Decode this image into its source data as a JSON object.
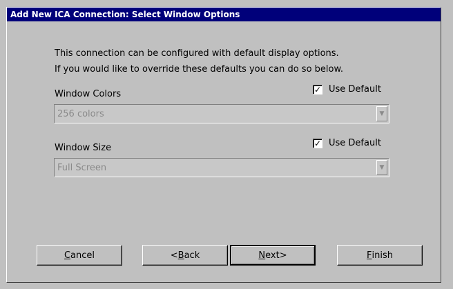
{
  "dialog": {
    "title": "Add New ICA Connection: Select Window Options",
    "intro_line1": "This connection can be configured with default display options.",
    "intro_line2": "If you would like to override these defaults you can do so below."
  },
  "window_colors": {
    "label": "Window Colors",
    "use_default_label": "Use Default",
    "use_default_checked": true,
    "value": "256 colors"
  },
  "window_size": {
    "label": "Window Size",
    "use_default_label": "Use Default",
    "use_default_checked": true,
    "value": "Full Screen"
  },
  "buttons": {
    "cancel": {
      "pre": "",
      "mnemonic": "C",
      "post": "ancel"
    },
    "back": {
      "pre": "<",
      "mnemonic": "B",
      "post": "ack"
    },
    "next": {
      "pre": "",
      "mnemonic": "N",
      "post": "ext>"
    },
    "finish": {
      "pre": "",
      "mnemonic": "F",
      "post": "inish"
    }
  },
  "icons": {
    "check": "checkmark-icon",
    "dropdown": "chevron-down-icon"
  }
}
